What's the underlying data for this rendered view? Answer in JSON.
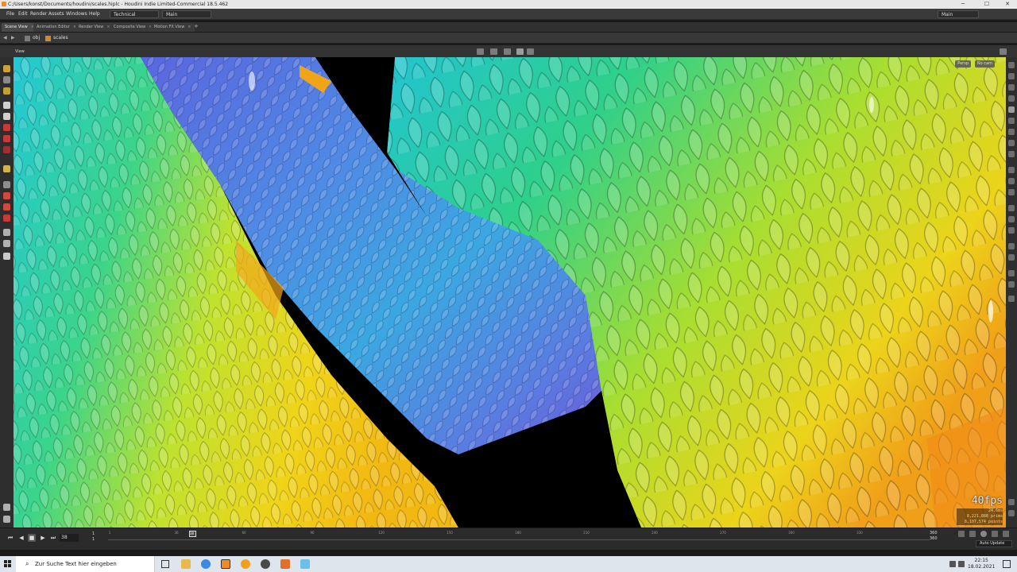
{
  "window": {
    "title": "C:/Users/konst/Documents/houdini/scales.hiplc - Houdini Indie Limited-Commercial 18.5.462",
    "controls": [
      "─",
      "☐",
      "✕"
    ]
  },
  "menu": {
    "items": [
      "File",
      "Edit",
      "Render",
      "Assets",
      "Windows",
      "Help"
    ],
    "desktop_left": "Technical",
    "desktop_mid": "Main",
    "desktop_right": "Main"
  },
  "tabs": [
    {
      "label": "Scene View",
      "active": true
    },
    {
      "label": "Animation Editor",
      "active": false
    },
    {
      "label": "Render View",
      "active": false
    },
    {
      "label": "Composite View",
      "active": false
    },
    {
      "label": "Motion FX View",
      "active": false
    }
  ],
  "tab_add": "+",
  "path": {
    "root": "obj",
    "node": "scales"
  },
  "view": {
    "label": "View",
    "camera_badge": "Persp",
    "cam_badge": "No cam"
  },
  "viewport_stats": {
    "fps": "40fps",
    "lines": [
      "24.6ms",
      "8,221,888 prims",
      "8,107,574 points"
    ]
  },
  "timeline": {
    "current_frame": "38",
    "start_frame": "1",
    "start_frame_b": "1",
    "end_frame": "360",
    "end_frame_b": "360",
    "cursor_label": "38",
    "tick_labels": [
      "1",
      "36",
      "60",
      "90",
      "120",
      "150",
      "180",
      "210",
      "240",
      "270",
      "300",
      "330"
    ],
    "auto_update": "Auto Update"
  },
  "taskbar": {
    "search_placeholder": "Zur Suche Text hier eingeben",
    "time": "22:15",
    "date": "18.02.2021"
  }
}
